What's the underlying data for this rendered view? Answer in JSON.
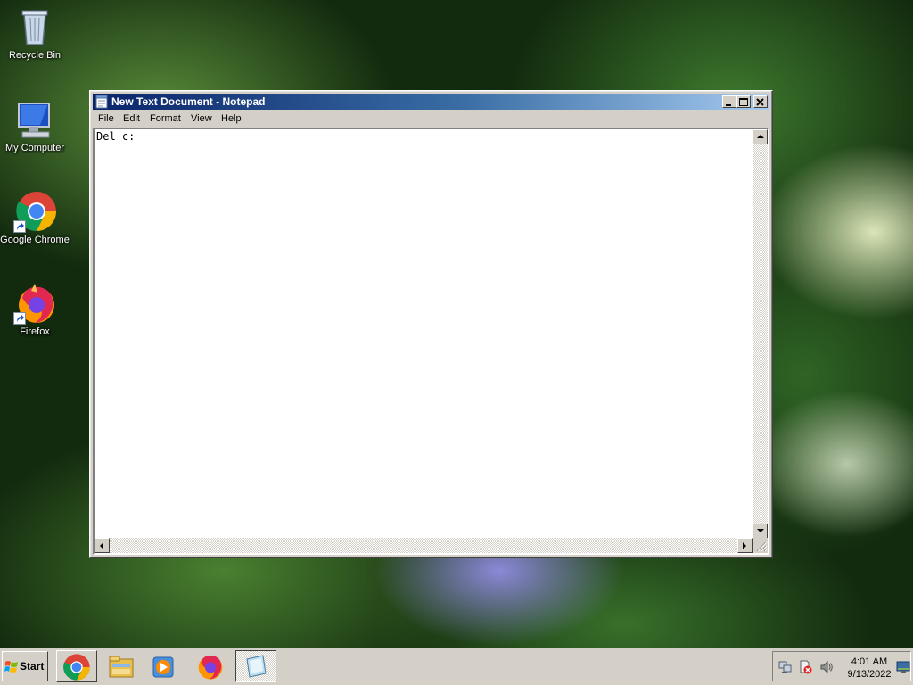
{
  "desktop": {
    "icons": [
      {
        "label": "Recycle Bin"
      },
      {
        "label": "My Computer"
      },
      {
        "label": "Google Chrome"
      },
      {
        "label": "Firefox"
      }
    ]
  },
  "window": {
    "title": "New Text Document - Notepad",
    "menu": [
      "File",
      "Edit",
      "Format",
      "View",
      "Help"
    ],
    "content": "Del c:"
  },
  "taskbar": {
    "start_label": "Start",
    "apps": [
      "chrome-icon",
      "file-explorer-icon",
      "media-player-icon",
      "firefox-icon",
      "notepad-icon"
    ],
    "clock_time": "4:01 AM",
    "clock_date": "9/13/2022"
  },
  "colors": {
    "title_start": "#0a246a",
    "title_end": "#a6caf0",
    "chrome_face": "#d4d0c8"
  }
}
